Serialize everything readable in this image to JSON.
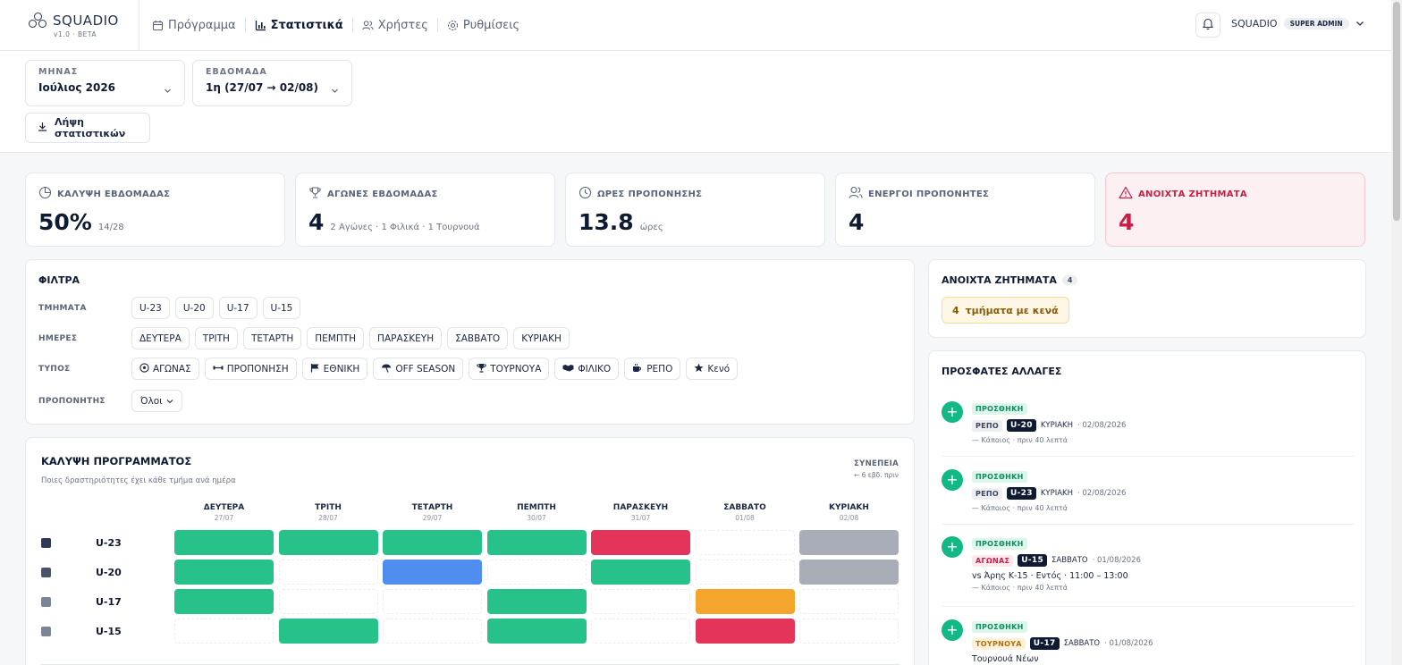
{
  "app": {
    "name": "SQUADIO",
    "version": "v1.0 · BETA"
  },
  "nav": [
    {
      "label": "Πρόγραμμα",
      "icon": "calendar-icon",
      "active": false
    },
    {
      "label": "Στατιστικά",
      "icon": "bar-chart-icon",
      "active": true
    },
    {
      "label": "Χρήστες",
      "icon": "users-icon",
      "active": false
    },
    {
      "label": "Ρυθμίσεις",
      "icon": "gear-icon",
      "active": false
    }
  ],
  "user": {
    "name": "SQUADIO",
    "role": "SUPER ADMIN"
  },
  "filters_top": {
    "month": {
      "label": "ΜΗΝΑΣ",
      "value": "Ιούλιος 2026"
    },
    "week": {
      "label": "ΕΒΔΟΜΑΔΑ",
      "value": "1η (27/07 → 02/08)"
    },
    "download_label": "Λήψη στατιστικών"
  },
  "kpis": [
    {
      "label": "ΚΑΛΥΨΗ ΕΒΔΟΜΑΔΑΣ",
      "value": "50%",
      "sub": "14/28",
      "icon": "pie-icon"
    },
    {
      "label": "ΑΓΩΝΕΣ ΕΒΔΟΜΑΔΑΣ",
      "value": "4",
      "sub": "2 Αγώνες · 1 Φιλικά · 1 Τουρνουά",
      "icon": "trophy-icon"
    },
    {
      "label": "ΩΡΕΣ ΠΡΟΠΟΝΗΣΗΣ",
      "value": "13.8",
      "sub": "ώρες",
      "icon": "clock-icon"
    },
    {
      "label": "ΕΝΕΡΓΟΙ ΠΡΟΠΟΝΗΤΕΣ",
      "value": "4",
      "sub": "",
      "icon": "users-icon"
    },
    {
      "label": "ΑΝΟΙΧΤΑ ΖΗΤΗΜΑΤΑ",
      "value": "4",
      "sub": "",
      "icon": "alert-icon"
    }
  ],
  "filters": {
    "title": "ΦΙΛΤΡΑ",
    "teams_label": "ΤΜΗΜΑΤΑ",
    "teams": [
      "U-23",
      "U-20",
      "U-17",
      "U-15"
    ],
    "days_label": "ΗΜΕΡΕΣ",
    "days": [
      "ΔΕΥΤΕΡΑ",
      "ΤΡΙΤΗ",
      "ΤΕΤΑΡΤΗ",
      "ΠΕΜΠΤΗ",
      "ΠΑΡΑΣΚΕΥΗ",
      "ΣΑΒΒΑΤΟ",
      "ΚΥΡΙΑΚΗ"
    ],
    "types_label": "ΤΥΠΟΣ",
    "types": [
      {
        "label": "ΑΓΩΝΑΣ",
        "icon": "ball-icon"
      },
      {
        "label": "ΠΡΟΠΟΝΗΣΗ",
        "icon": "dumbbell-icon"
      },
      {
        "label": "ΕΘΝΙΚΗ",
        "icon": "flag-icon"
      },
      {
        "label": "OFF SEASON",
        "icon": "umbrella-icon"
      },
      {
        "label": "ΤΟΥΡΝΟΥΑ",
        "icon": "trophy-icon"
      },
      {
        "label": "ΦΙΛΙΚΟ",
        "icon": "handshake-icon"
      },
      {
        "label": "ΡΕΠΟ",
        "icon": "coffee-icon"
      },
      {
        "label": "Κενό",
        "icon": "star-icon"
      }
    ],
    "coach_label": "ΠΡΟΠΟΝΗΤΗΣ",
    "coach_value": "Όλοι"
  },
  "coverage": {
    "title": "ΚΑΛΥΨΗ ΠΡΟΓΡΑΜΜΑΤΟΣ",
    "subtitle": "Ποιες δραστηριότητες έχει κάθε τμήμα ανά ημέρα",
    "link_top": "ΣΥΝΕΠΕΙΑ",
    "link_bottom": "← 6 εβδ. πριν",
    "days": [
      {
        "day": "ΔΕΥΤΕΡΑ",
        "date": "27/07"
      },
      {
        "day": "ΤΡΙΤΗ",
        "date": "28/07"
      },
      {
        "day": "ΤΕΤΑΡΤΗ",
        "date": "29/07"
      },
      {
        "day": "ΠΕΜΠΤΗ",
        "date": "30/07"
      },
      {
        "day": "ΠΑΡΑΣΚΕΥΗ",
        "date": "31/07"
      },
      {
        "day": "ΣΑΒΒΑΤΟ",
        "date": "01/08"
      },
      {
        "day": "ΚΥΡΙΑΚΗ",
        "date": "02/08"
      }
    ],
    "colors": {
      "training": "#27c28a",
      "match": "#e5345a",
      "repo": "#a8adb8",
      "national": "#4f8ef0",
      "tournament": "#f4a52b"
    },
    "rows": [
      {
        "team": "U-23",
        "cells": [
          "training",
          "training",
          "training",
          "training",
          "match",
          "",
          "repo"
        ]
      },
      {
        "team": "U-20",
        "cells": [
          "training",
          "",
          "national",
          "",
          "training",
          "",
          "repo"
        ]
      },
      {
        "team": "U-17",
        "cells": [
          "training",
          "",
          "",
          "training",
          "",
          "tournament",
          ""
        ]
      },
      {
        "team": "U-15",
        "cells": [
          "",
          "training",
          "",
          "training",
          "",
          "match",
          ""
        ]
      }
    ]
  },
  "issues": {
    "title": "ΑΝΟΙΧΤΑ ΖΗΤΗΜΑΤΑ",
    "count": "4",
    "pill_count": "4",
    "pill_text": "τμήματα με κενά"
  },
  "changes": {
    "title": "ΠΡΟΣΦΑΤΕΣ ΑΛΛΑΓΕΣ",
    "items": [
      {
        "action": "ΠΡΟΣΘΗΚΗ",
        "type": "ΡΕΠΟ",
        "type_kind": "repo",
        "team": "U-20",
        "day": "ΚΥΡΙΑΚΗ",
        "date": "· 02/08/2026",
        "desc": "",
        "meta": "— Κάποιος · πριν 40 λεπτά"
      },
      {
        "action": "ΠΡΟΣΘΗΚΗ",
        "type": "ΡΕΠΟ",
        "type_kind": "repo",
        "team": "U-23",
        "day": "ΚΥΡΙΑΚΗ",
        "date": "· 02/08/2026",
        "desc": "",
        "meta": "— Κάποιος · πριν 40 λεπτά"
      },
      {
        "action": "ΠΡΟΣΘΗΚΗ",
        "type": "ΑΓΩΝΑΣ",
        "type_kind": "match",
        "team": "U-15",
        "day": "ΣΑΒΒΑΤΟ",
        "date": "· 01/08/2026",
        "desc": "vs Άρης Κ-15 · Εντός · 11:00 – 13:00",
        "meta": "— Κάποιος · πριν 40 λεπτά"
      },
      {
        "action": "ΠΡΟΣΘΗΚΗ",
        "type": "ΤΟΥΡΝΟΥΑ",
        "type_kind": "tourn",
        "team": "U-17",
        "day": "ΣΑΒΒΑΤΟ",
        "date": "· 01/08/2026",
        "desc": "Τουρνουά Νέων",
        "meta": ""
      }
    ]
  }
}
